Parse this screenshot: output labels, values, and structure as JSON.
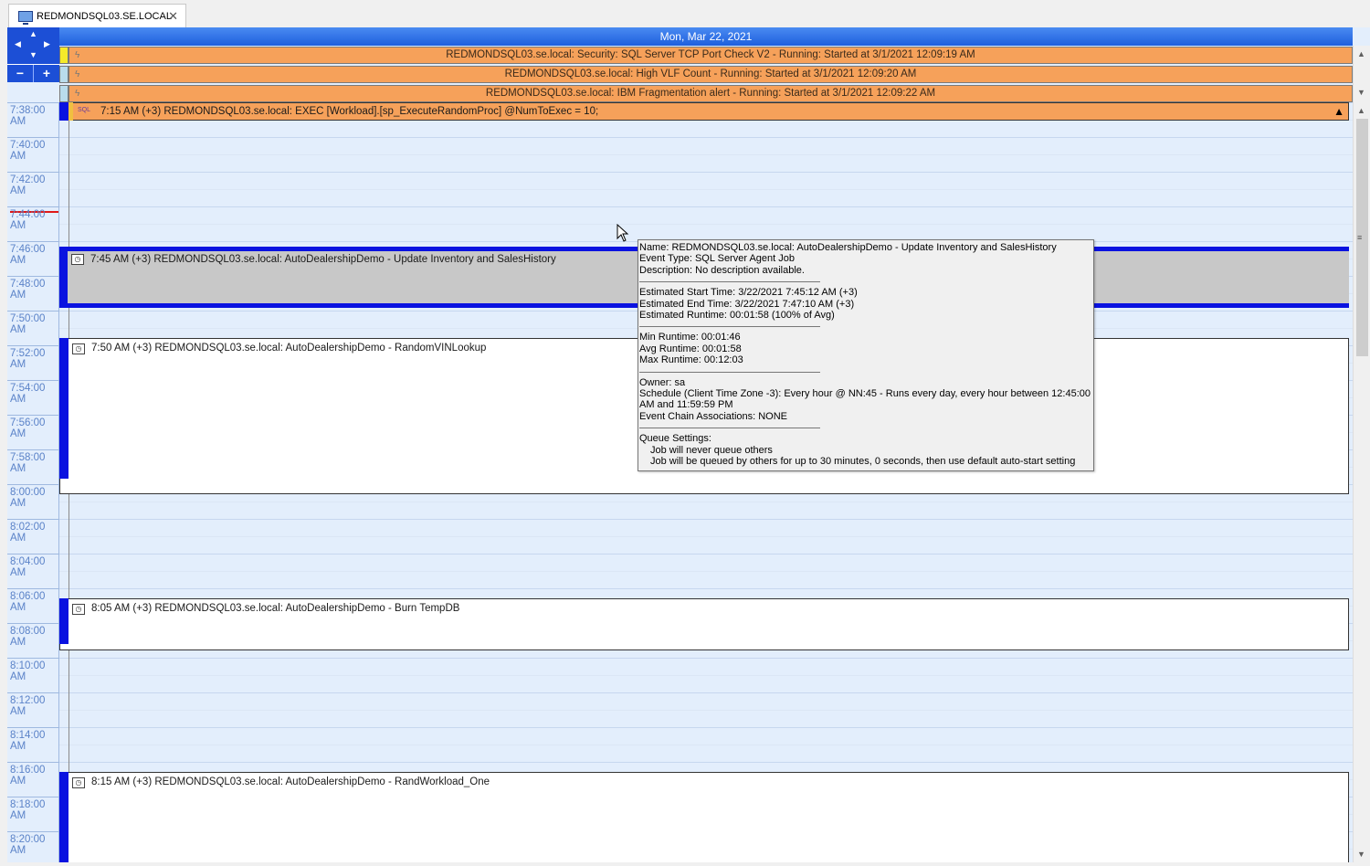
{
  "tab": {
    "label": "REDMONDSQL03.SE.LOCAL"
  },
  "calendar": {
    "date_header": "Mon, Mar 22, 2021"
  },
  "allday_events": [
    {
      "text": "REDMONDSQL03.se.local: Security: SQL Server TCP Port Check V2  -  Running: Started at 3/1/2021 12:09:19 AM",
      "mark_color": "#f5ea2a"
    },
    {
      "text": "REDMONDSQL03.se.local: High VLF Count  -  Running: Started at 3/1/2021 12:09:20 AM",
      "mark_color": "#b9dcec"
    },
    {
      "text": "REDMONDSQL03.se.local: IBM Fragmentation alert  -  Running: Started at 3/1/2021 12:09:22 AM",
      "mark_color": "#b9dcec"
    }
  ],
  "time_slots": [
    {
      "time": "7:38:00",
      "ampm": "AM"
    },
    {
      "time": "7:40:00",
      "ampm": "AM"
    },
    {
      "time": "7:42:00",
      "ampm": "AM"
    },
    {
      "time": "7:44:00",
      "ampm": "AM"
    },
    {
      "time": "7:46:00",
      "ampm": "AM"
    },
    {
      "time": "7:48:00",
      "ampm": "AM"
    },
    {
      "time": "7:50:00",
      "ampm": "AM"
    },
    {
      "time": "7:52:00",
      "ampm": "AM"
    },
    {
      "time": "7:54:00",
      "ampm": "AM"
    },
    {
      "time": "7:56:00",
      "ampm": "AM"
    },
    {
      "time": "7:58:00",
      "ampm": "AM"
    },
    {
      "time": "8:00:00",
      "ampm": "AM"
    },
    {
      "time": "8:02:00",
      "ampm": "AM"
    },
    {
      "time": "8:04:00",
      "ampm": "AM"
    },
    {
      "time": "8:06:00",
      "ampm": "AM"
    },
    {
      "time": "8:08:00",
      "ampm": "AM"
    },
    {
      "time": "8:10:00",
      "ampm": "AM"
    },
    {
      "time": "8:12:00",
      "ampm": "AM"
    },
    {
      "time": "8:14:00",
      "ampm": "AM"
    },
    {
      "time": "8:16:00",
      "ampm": "AM"
    },
    {
      "time": "8:18:00",
      "ampm": "AM"
    },
    {
      "time": "8:20:00",
      "ampm": "AM"
    }
  ],
  "events": {
    "sql": {
      "text": "7:15 AM (+3)  REDMONDSQL03.se.local: EXEC [Workload].[sp_ExecuteRandomProc] @NumToExec = 10;",
      "icon": "SQL"
    },
    "update_inventory": {
      "text": "7:45 AM (+3)  REDMONDSQL03.se.local: AutoDealershipDemo - Update Inventory and SalesHistory"
    },
    "random_vin": {
      "text": "7:50 AM (+3)  REDMONDSQL03.se.local: AutoDealershipDemo - RandomVINLookup"
    },
    "burn_tempdb": {
      "text": "8:05 AM (+3)  REDMONDSQL03.se.local: AutoDealershipDemo - Burn TempDB"
    },
    "rand_workload": {
      "text": "8:15 AM (+3)  REDMONDSQL03.se.local: AutoDealershipDemo - RandWorkload_One"
    }
  },
  "tooltip": {
    "name": "Name: REDMONDSQL03.se.local: AutoDealershipDemo - Update Inventory and SalesHistory",
    "event_type": "Event Type: SQL Server Agent Job",
    "description": "Description: No description available.",
    "est_start": "Estimated Start Time: 3/22/2021 7:45:12 AM (+3)",
    "est_end": "Estimated End Time: 3/22/2021 7:47:10 AM (+3)",
    "est_runtime": "Estimated Runtime: 00:01:58 (100% of Avg)",
    "min_runtime": "Min Runtime: 00:01:46",
    "avg_runtime": "Avg Runtime: 00:01:58",
    "max_runtime": "Max Runtime: 00:12:03",
    "owner": "Owner: sa",
    "schedule": "Schedule (Client Time Zone -3): Every hour @ NN:45 - Runs every day, every hour between 12:45:00 AM and 11:59:59 PM",
    "chain": "Event Chain Associations: NONE",
    "queue_title": "Queue Settings:",
    "queue_1": "Job will never queue others",
    "queue_2": "Job will be queued by others for up to 30 minutes, 0 seconds, then use default auto-start setting"
  },
  "colors": {
    "header_blue": "#1c4fd6",
    "event_orange": "#f6a15a",
    "status_strip_blue": "#0a12e0",
    "now_line_red": "#e01818"
  }
}
